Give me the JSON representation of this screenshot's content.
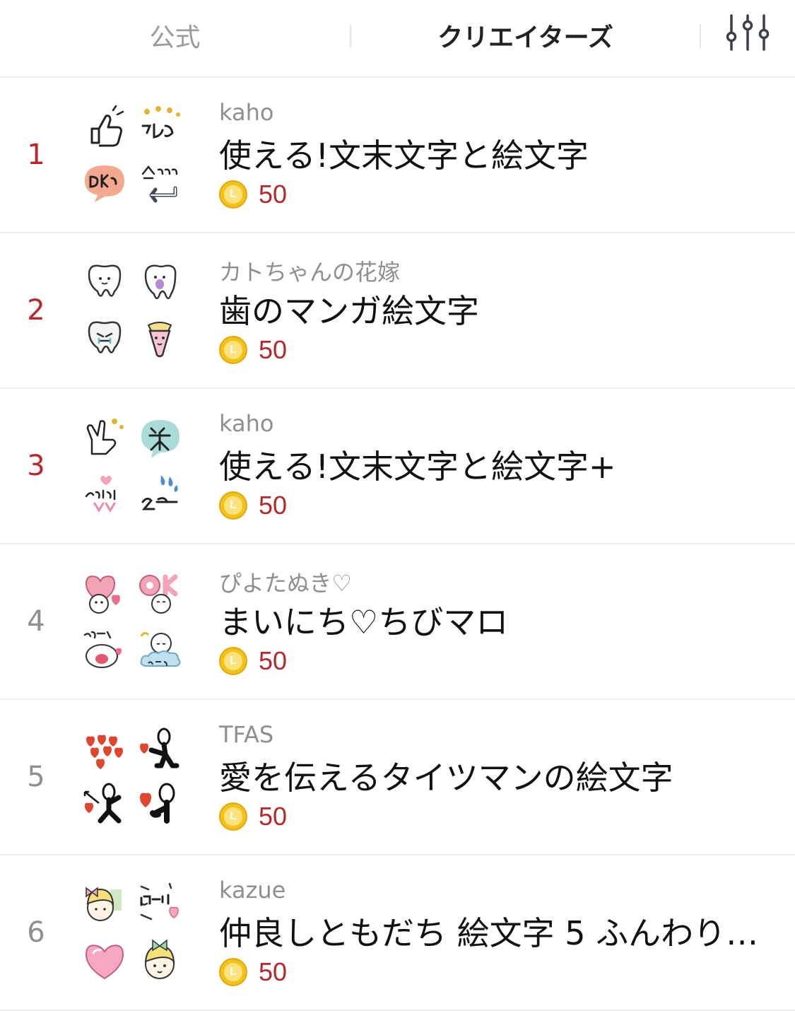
{
  "tabs": {
    "official": "公式",
    "creators": "クリエイターズ"
  },
  "icons": {
    "filter": "sliders-icon",
    "coin": "line-coin-icon"
  },
  "colors": {
    "rank_top": "#b8262b",
    "rank_other": "#8e8e93",
    "price": "#b8262b",
    "coin": "#f2c21b"
  },
  "items": [
    {
      "rank": "1",
      "author": "kaho",
      "title": "使える!文末文字と絵文字",
      "coin_letter": "L",
      "price": "50"
    },
    {
      "rank": "2",
      "author": "カトちゃんの花嫁",
      "title": "歯のマンガ絵文字",
      "coin_letter": "L",
      "price": "50"
    },
    {
      "rank": "3",
      "author": "kaho",
      "title": "使える!文末文字と絵文字+",
      "coin_letter": "L",
      "price": "50"
    },
    {
      "rank": "4",
      "author": "ぴよたぬき♡",
      "title": "まいにち♡ちびマロ",
      "coin_letter": "L",
      "price": "50"
    },
    {
      "rank": "5",
      "author": "TFAS",
      "title": "愛を伝えるタイツマンの絵文字",
      "coin_letter": "L",
      "price": "50"
    },
    {
      "rank": "6",
      "author": "kazue",
      "title": "仲良しともだち 絵文字 5 ふんわり…",
      "coin_letter": "L",
      "price": "50"
    }
  ]
}
